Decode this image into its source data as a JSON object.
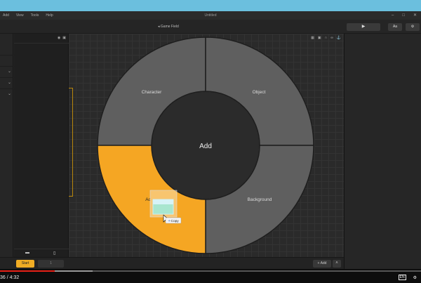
{
  "titlebar": {
    "menu": [
      "Add",
      "View",
      "Tools",
      "Help"
    ],
    "title": "Untitled"
  },
  "toolbar": {
    "scene_label": "Game Field",
    "play_icon": "play-icon",
    "text_button": "Aa",
    "settings_icon": "gear-icon"
  },
  "pie_menu": {
    "center_label": "Add",
    "segments": [
      {
        "label": "Character",
        "color": "#5f5f5f"
      },
      {
        "label": "Object",
        "color": "#5f5f5f"
      },
      {
        "label": "Background",
        "color": "#5f5f5f"
      },
      {
        "label": "Action",
        "label_visible": "Ac",
        "color": "#f5a623",
        "highlighted": true
      }
    ],
    "drag_tooltip": "Copy"
  },
  "bottom_bar": {
    "start_label": "Start",
    "page_value": "1",
    "add_label": "+ Add",
    "up_icon": "chevron-up-icon"
  },
  "player": {
    "time": "36 / 4:32",
    "played_fraction": 0.13,
    "buffered_fraction": 0.22
  },
  "colors": {
    "accent": "#f5a623",
    "segment": "#5f5f5f",
    "hub": "#2b2b2b"
  }
}
